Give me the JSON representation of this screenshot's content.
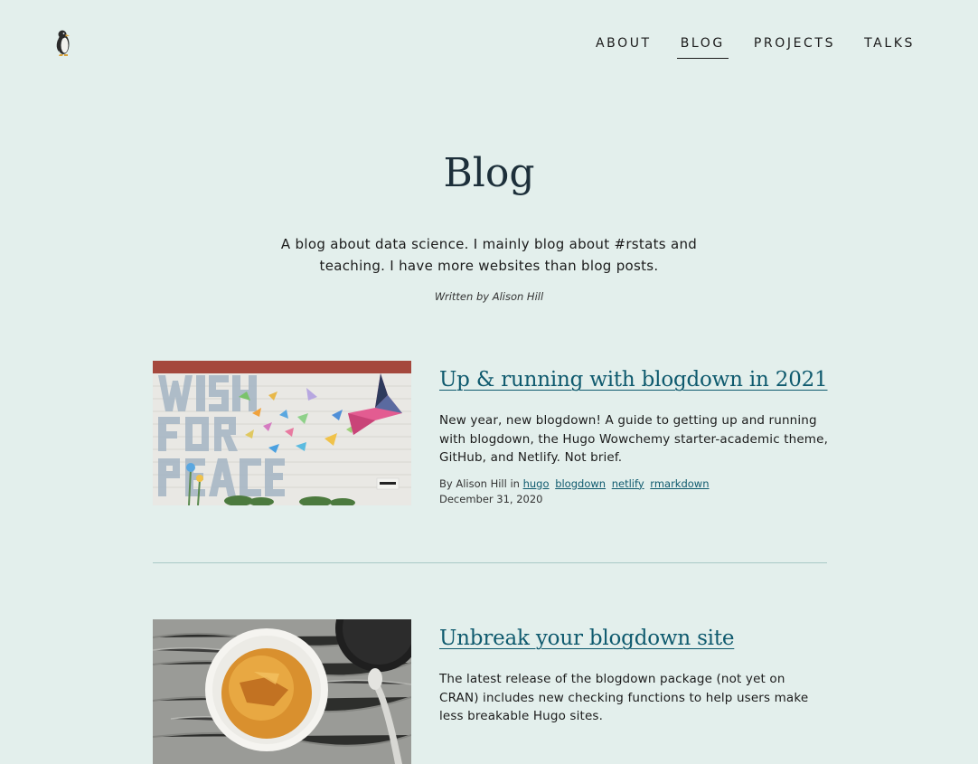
{
  "header": {
    "logo_icon": "penguin-logo-icon",
    "nav": [
      {
        "label": "ABOUT",
        "active": false
      },
      {
        "label": "BLOG",
        "active": true
      },
      {
        "label": "PROJECTS",
        "active": false
      },
      {
        "label": "TALKS",
        "active": false
      }
    ]
  },
  "page": {
    "title": "Blog",
    "description": "A blog about data science. I mainly blog about #rstats and teaching. I have more websites than blog posts.",
    "byline": "Written by Alison Hill"
  },
  "posts": [
    {
      "title": "Up & running with blogdown in 2021",
      "summary": "New year, new blogdown! A guide to getting up and running with blogdown, the Hugo Wowchemy starter-academic theme, GitHub, and Netlify. Not brief.",
      "author_prefix": "By Alison Hill in",
      "tags": [
        "hugo",
        "blogdown",
        "netlify",
        "rmarkdown"
      ],
      "date": "December 31, 2020",
      "image_icon": "wish-for-peace-mural-image",
      "image_text": "WISH FOR PEACE"
    },
    {
      "title": "Unbreak your blogdown site",
      "summary": "The latest release of the blogdown package (not yet on CRAN) includes new checking functions to help users make less breakable Hugo sites.",
      "image_icon": "creme-brulee-image"
    }
  ],
  "colors": {
    "background": "#e3efec",
    "link": "#0f5a6e",
    "title": "#1d2f3a",
    "divider": "#a9c9c7"
  }
}
